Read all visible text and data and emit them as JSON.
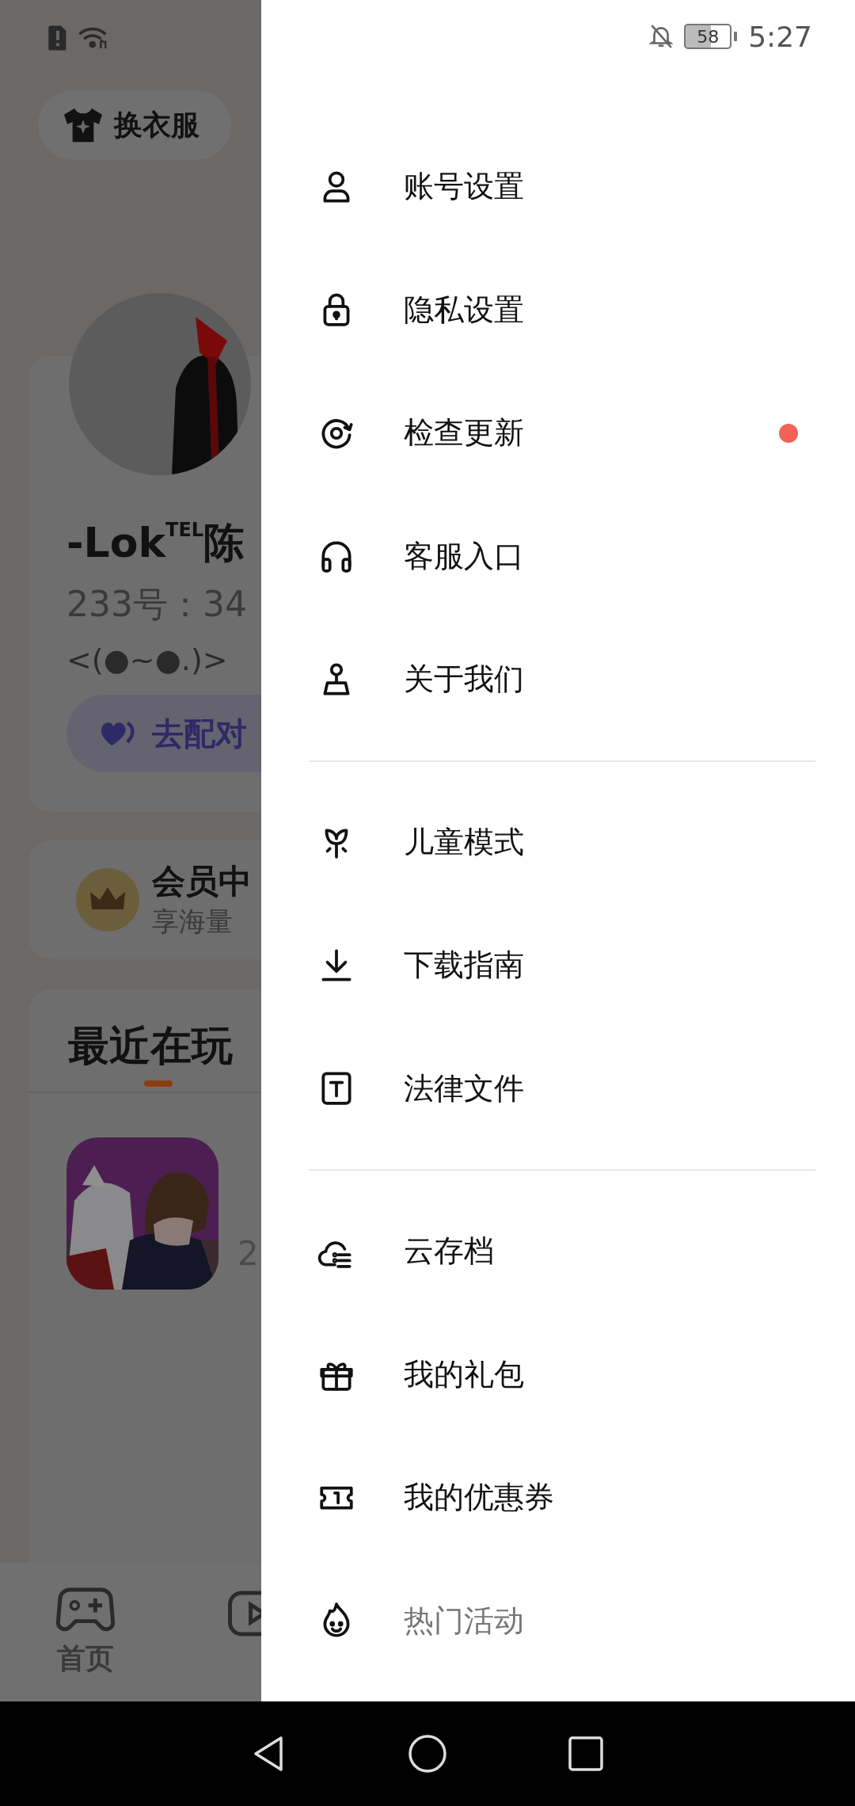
{
  "status_bar": {
    "battery": "58",
    "time": "5:27"
  },
  "background": {
    "outfit_button": "换衣服",
    "profile": {
      "name": "-Lok$^{TEL}$陈",
      "id": "233号：34",
      "signature": "<(●~●.)>",
      "match_button": "去配对"
    },
    "vip": {
      "title": "会员中",
      "subtitle": "享海量"
    },
    "recent": {
      "title": "最近在玩",
      "game_line": "2"
    },
    "bottom_nav": [
      {
        "label": "首页"
      }
    ]
  },
  "drawer": {
    "groups": [
      {
        "items": [
          {
            "label": "账号设置",
            "badge": false
          },
          {
            "label": "隐私设置",
            "badge": false
          },
          {
            "label": "检查更新",
            "badge": true
          },
          {
            "label": "客服入口",
            "badge": false
          },
          {
            "label": "关于我们",
            "badge": false
          }
        ]
      },
      {
        "items": [
          {
            "label": "儿童模式",
            "badge": false
          },
          {
            "label": "下载指南",
            "badge": false
          },
          {
            "label": "法律文件",
            "badge": false
          }
        ]
      },
      {
        "items": [
          {
            "label": "云存档",
            "badge": false
          },
          {
            "label": "我的礼包",
            "badge": false
          },
          {
            "label": "我的优惠券",
            "badge": false
          },
          {
            "label": "热门活动",
            "badge": false
          }
        ]
      }
    ]
  }
}
